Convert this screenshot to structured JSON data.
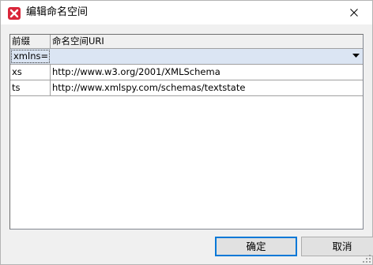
{
  "window": {
    "title": "编辑命名空间"
  },
  "icons": {
    "app": "app-icon",
    "close": "close-icon",
    "dropdown": "dropdown-arrow-icon",
    "grip": "resize-grip-icon"
  },
  "colors": {
    "selected_row": "#dbe5f3",
    "default_button_border": "#0078d7",
    "app_icon_red": "#d9263a"
  },
  "grid": {
    "headers": {
      "prefix": "前缀",
      "uri": "命名空间URI"
    },
    "rows": [
      {
        "prefix": "xmlns=",
        "uri": ""
      },
      {
        "prefix": "xs",
        "uri": "http://www.w3.org/2001/XMLSchema"
      },
      {
        "prefix": "ts",
        "uri": "http://www.xmlspy.com/schemas/textstate"
      }
    ]
  },
  "buttons": {
    "ok": "确定",
    "cancel": "取消"
  }
}
